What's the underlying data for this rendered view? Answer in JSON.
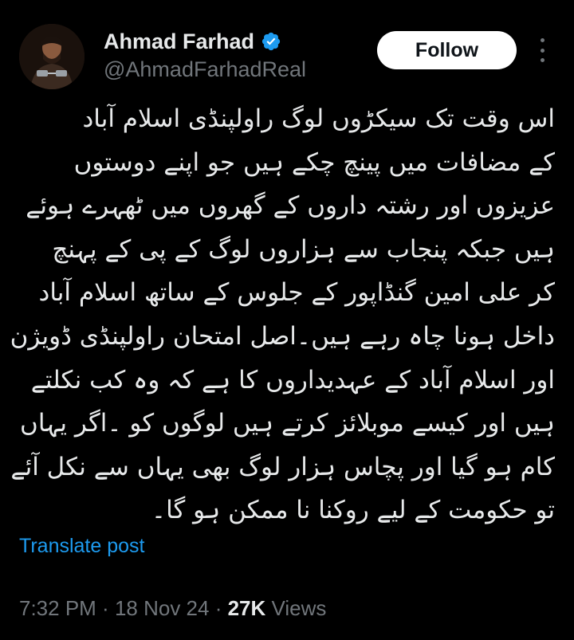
{
  "author": {
    "display_name": "Ahmad Farhad",
    "handle": "@AhmadFarhadReal",
    "verified": true
  },
  "follow_label": "Follow",
  "tweet_lines": [
    "اس وقت تک سیکڑوں لوگ راولپنڈی اسلام آباد",
    "کے مضافات میں پینچ چکے ہیں جو اپنے دوستوں",
    "عزیزوں اور رشتہ داروں کے گھروں میں ٹھہرے ہوئے",
    "ہیں جبکہ پنجاب سے ہزاروں لوگ کے پی کے پہنچ",
    "کر علی امین گنڈاپور کے جلوس کے ساتھ اسلام آباد",
    "داخل ہونا چاہ رہے ہیں۔اصل امتحان راولپنڈی ڈویژن",
    "اور اسلام آباد کے عہدیداروں کا ہے کہ وہ کب نکلتے",
    "ہیں اور کیسے موبلائز کرتے ہیں لوگوں کو ۔اگر یہاں",
    "کام ہو گیا اور پچاس ہزار لوگ بھی یہاں سے نکل آئے",
    "تو حکومت کے لیے روکنا نا ممکن ہو گا۔"
  ],
  "translate_label": "Translate post",
  "meta": {
    "time": "7:32 PM",
    "separator": " · ",
    "date": "18 Nov 24",
    "views_count": "27K",
    "views_label": " Views"
  },
  "colors": {
    "background": "#000000",
    "text": "#e7e9ea",
    "secondary": "#71767b",
    "link": "#1d9bf0",
    "verified": "#1d9bf0"
  },
  "icons": {
    "verified": "verified-badge-icon",
    "more": "more-horizontal-icon"
  }
}
